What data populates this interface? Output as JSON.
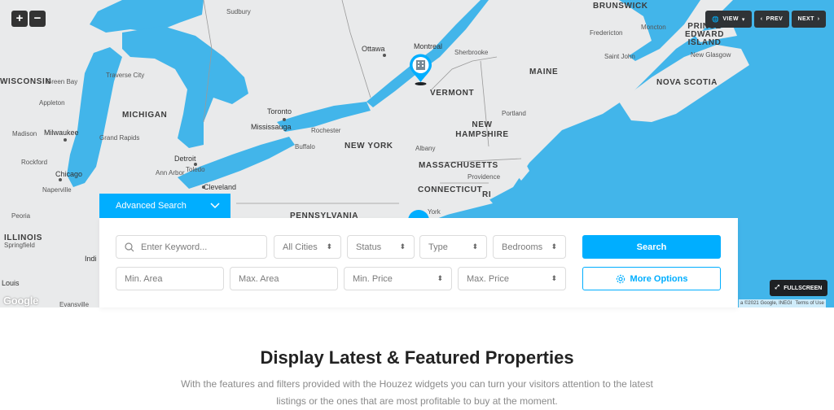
{
  "map": {
    "zoom_in": "+",
    "zoom_out": "−",
    "view_label": "VIEW",
    "prev_label": "PREV",
    "next_label": "NEXT",
    "fullscreen_label": "FULLSCREEN",
    "google_logo": "Google",
    "attribution_data": "a ©2021 Google, INEGI",
    "attribution_terms": "Terms of Use",
    "labels": {
      "sudbury": "Sudbury",
      "brunswick": "BRUNSWICK",
      "fredericton": "Fredericton",
      "moncton": "Moncton",
      "prince_edward_island": "PRINCE EDWARD ISLAND",
      "saint_john": "Saint John",
      "new_glasgow": "New Glasgow",
      "ottawa": "Ottawa",
      "montreal": "Montreal",
      "sherbrooke": "Sherbrooke",
      "wisconsin": "WISCONSIN",
      "green_bay": "Green Bay",
      "traverse_city": "Traverse City",
      "maine": "MAINE",
      "nova_scotia": "NOVA SCOTIA",
      "vermont": "VERMONT",
      "appleton": "Appleton",
      "michigan": "MICHIGAN",
      "toronto": "Toronto",
      "mississauga": "Mississauga",
      "portland": "Portland",
      "new_hampshire": "NEW HAMPSHIRE",
      "rochester": "Rochester",
      "madison": "Madison",
      "milwaukee": "Milwaukee",
      "grand_rapids": "Grand Rapids",
      "buffalo": "Buffalo",
      "new_york": "NEW YORK",
      "albany": "Albany",
      "detroit": "Detroit",
      "rockford": "Rockford",
      "ann_arbor": "Ann Arbor",
      "toledo": "Toledo",
      "massachusetts": "MASSACHUSETTS",
      "chicago": "Chicago",
      "providence": "Providence",
      "naperville": "Naperville",
      "cleveland": "Cleveland",
      "connecticut": "CONNECTICUT",
      "ri": "RI",
      "pennsylvania": "PENNSYLVANIA",
      "york": "York",
      "peoria": "Peoria",
      "illinois": "ILLINOIS",
      "springfield": "Springfield",
      "indi": "Indi",
      "louis": "Louis",
      "evansville": "Evansville"
    }
  },
  "search": {
    "tab_label": "Advanced Search",
    "keyword_placeholder": "Enter Keyword...",
    "cities_label": "All Cities",
    "status_label": "Status",
    "type_label": "Type",
    "bedrooms_label": "Bedrooms",
    "min_area_placeholder": "Min. Area",
    "max_area_placeholder": "Max. Area",
    "min_price_label": "Min. Price",
    "max_price_label": "Max. Price",
    "search_button": "Search",
    "more_options_button": "More Options"
  },
  "section": {
    "heading": "Display Latest & Featured Properties",
    "description": "With the features and filters provided with the Houzez widgets you can turn your visitors attention to the latest listings or the ones that are most profitable to buy at the moment."
  },
  "colors": {
    "accent": "#00aeff",
    "water": "#42b5ea",
    "land": "#e9eaeb"
  }
}
